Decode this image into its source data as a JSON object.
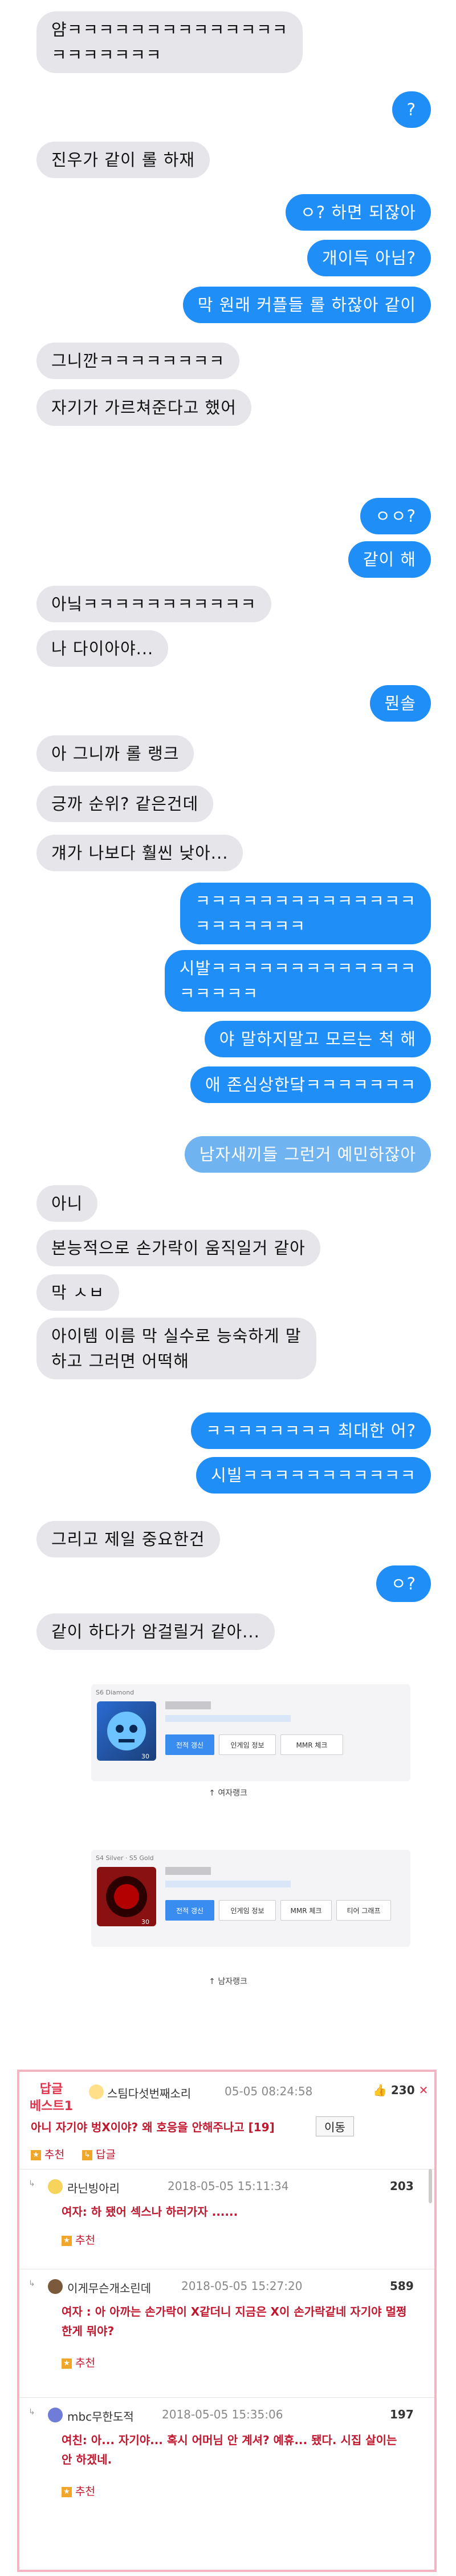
{
  "chat": {
    "messages": [
      {
        "side": "in",
        "lines": [
          "얌ㅋㅋㅋㅋㅋㅋㅋㅋㅋㅋㅋㅋㅋㅋ",
          "ㅋㅋㅋㅋㅋㅋㅋ"
        ]
      },
      {
        "side": "out",
        "text": "?"
      },
      {
        "side": "in",
        "text": "진우가 같이 롤 하재"
      },
      {
        "side": "out",
        "text": "ㅇ? 하면 되잖아"
      },
      {
        "side": "out",
        "text": "개이득 아님?"
      },
      {
        "side": "out",
        "text": "막 원래 커플들 롤 하잖아 같이"
      },
      {
        "side": "in",
        "text": "그니깐ㅋㅋㅋㅋㅋㅋㅋㅋ"
      },
      {
        "side": "in",
        "text": "자기가 가르쳐준다고 했어"
      },
      {
        "side": "out",
        "text": "ㅇㅇ?"
      },
      {
        "side": "out",
        "text": "같이 해"
      },
      {
        "side": "in",
        "text": "아닠ㅋㅋㅋㅋㅋㅋㅋㅋㅋㅋㅋ"
      },
      {
        "side": "in",
        "text": "나 다이아야..."
      },
      {
        "side": "out",
        "text": "뭔솔"
      },
      {
        "side": "in",
        "text": "아 그니까 롤 랭크"
      },
      {
        "side": "in",
        "text": "긍까 순위? 같은건데"
      },
      {
        "side": "in",
        "text": "걔가 나보다 훨씬 낮아..."
      },
      {
        "side": "out",
        "lines": [
          "ㅋㅋㅋㅋㅋㅋㅋㅋㅋㅋㅋㅋㅋㅋ",
          "ㅋㅋㅋㅋㅋㅋㅋ"
        ]
      },
      {
        "side": "out",
        "lines": [
          "시발ㅋㅋㅋㅋㅋㅋㅋㅋㅋㅋㅋㅋㅋ",
          "ㅋㅋㅋㅋㅋ"
        ]
      },
      {
        "side": "out",
        "text": "야 말하지말고 모르는 척 해"
      },
      {
        "side": "out",
        "text": "애 존심상한닼ㅋㅋㅋㅋㅋㅋㅋ"
      },
      {
        "side": "out",
        "text": "남자새끼들 그런거 예민하잖아"
      },
      {
        "side": "in",
        "text": "아니"
      },
      {
        "side": "in",
        "text": "본능적으로 손가락이 움직일거 같아"
      },
      {
        "side": "in",
        "text": "막 ㅅㅂ"
      },
      {
        "side": "in",
        "lines": [
          "아이템 이름 막 실수로 능숙하게 말",
          "하고 그러면 어떡해"
        ]
      },
      {
        "side": "out",
        "text": "ㅋㅋㅋㅋㅋㅋㅋㅋ 최대한 어?"
      },
      {
        "side": "out",
        "text": "시빌ㅋㅋㅋㅋㅋㅋㅋㅋㅋㅋㅋ"
      },
      {
        "side": "in",
        "text": "그리고 제일 중요한건"
      },
      {
        "side": "out",
        "text": "ㅇ?"
      },
      {
        "side": "in",
        "text": "같이 하다가 암걸릴거 같아..."
      }
    ]
  },
  "rank_cards": [
    {
      "tier_tag": "S6 Diamond",
      "level": "30",
      "buttons": [
        "전적 갱신",
        "인게임 정보",
        "MMR 체크"
      ],
      "caption": "↑ 여자랭크"
    },
    {
      "tier_tag": "S4 Silver · S5 Gold",
      "level": "30",
      "buttons": [
        "전적 갱신",
        "인게임 정보",
        "MMR 체크",
        "티어 그래프"
      ],
      "caption": "↑ 남자랭크"
    }
  ],
  "comments": {
    "best_label_1": "답글",
    "best_label_2": "베스트1",
    "best_nick": "스팀다섯번째소리",
    "best_date": "05-05 08:24:58",
    "best_score": "230",
    "best_text": "아니 자기야 벙X이야? 왜 호응을 안해주나고 [19]",
    "move_label": "이동",
    "recommend_label": "추천",
    "reply_label": "답글",
    "items": [
      {
        "nick": "라닌빙아리",
        "date": "2018-05-05 15:11:34",
        "score": "203",
        "text": "여자: 하 됐어 섹스나 하러가자 ......",
        "action": "추천"
      },
      {
        "nick": "이게무슨개소린데",
        "date": "2018-05-05 15:27:20",
        "score": "589",
        "text": "여자 : 아 아까는 손가락이 X같더니 지금은 X이 손가락같네 자기야 멀쩡한게 뭐야?",
        "action": "추천"
      },
      {
        "nick": "mbc무한도적",
        "date": "2018-05-05 15:35:06",
        "score": "197",
        "text": "여친: 아... 자기야... 혹시 어머님 안 계셔? 예휴... 됐다. 시집 살이는 안 하겠네.",
        "action": "추천"
      }
    ]
  }
}
